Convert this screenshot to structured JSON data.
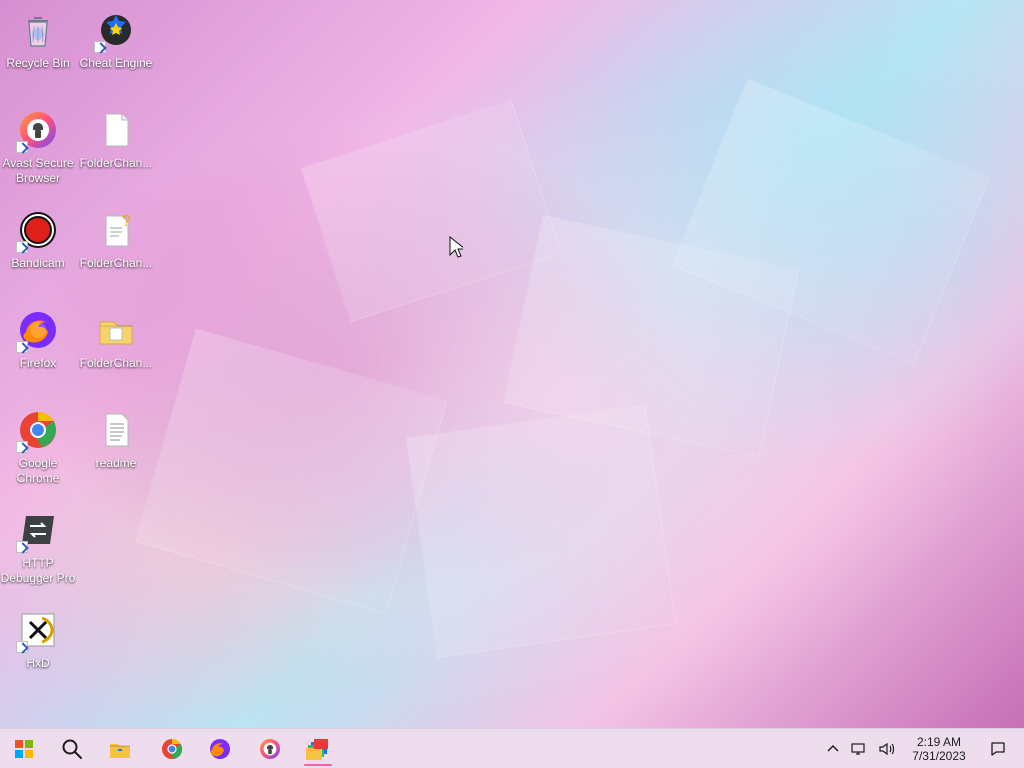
{
  "desktop": {
    "icons": [
      {
        "label": "Recycle Bin"
      },
      {
        "label": "Cheat Engine"
      },
      {
        "label": "Avast Secure\nBrowser"
      },
      {
        "label": "FolderChan..."
      },
      {
        "label": "Bandicam"
      },
      {
        "label": "FolderChan..."
      },
      {
        "label": "Firefox"
      },
      {
        "label": "FolderChan..."
      },
      {
        "label": "Google\nChrome"
      },
      {
        "label": "readme"
      },
      {
        "label": "HTTP\nDebugger Pro"
      },
      {
        "label": "HxD"
      }
    ]
  },
  "taskbar": {
    "clock": {
      "time": "2:19 AM",
      "date": "7/31/2023"
    }
  },
  "icons": {
    "start": "windows-start-icon",
    "search": "search-icon",
    "explorer": "file-explorer-icon",
    "chrome": "chrome-icon",
    "firefox": "firefox-icon",
    "avast": "avast-secure-browser-icon",
    "folder_changer": "folder-changer-app-icon",
    "tray_chevron": "chevron-up-icon",
    "network": "network-icon",
    "volume": "volume-icon",
    "notifications": "notification-icon"
  },
  "colors": {
    "taskbar_bg": "#ecdaeb",
    "active_underline": "#ff5ea8"
  }
}
